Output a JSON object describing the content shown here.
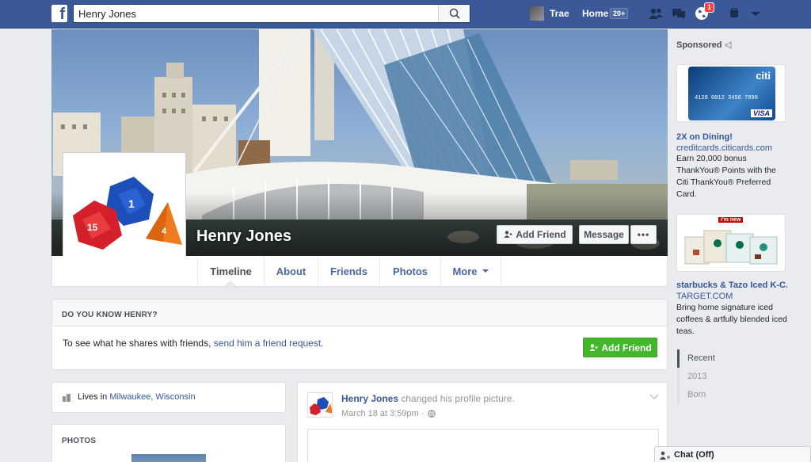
{
  "nav": {
    "search_value": "Henry Jones",
    "user_name": "Trae",
    "home_label": "Home",
    "home_count": "20+",
    "notification_count": "1"
  },
  "profile": {
    "name": "Henry Jones",
    "add_friend_label": "Add Friend",
    "message_label": "Message",
    "more_dots": "•••"
  },
  "tabs": [
    "Timeline",
    "About",
    "Friends",
    "Photos",
    "More"
  ],
  "know_card": {
    "heading": "DO YOU KNOW HENRY?",
    "text": "To see what he shares with friends, ",
    "link": "send him a friend request.",
    "button": "Add Friend"
  },
  "intro": {
    "lives_prefix": "Lives in ",
    "city": "Milwaukee, Wisconsin"
  },
  "photos_card": {
    "heading": "PHOTOS"
  },
  "post": {
    "author": "Henry Jones",
    "action": " changed his profile picture.",
    "timestamp": "March 18 at 3:59pm ·"
  },
  "sidebar": {
    "sponsored": "Sponsored",
    "ad1": {
      "title": "2X on Dining!",
      "domain": "creditcards.citicards.com",
      "text": "Earn 20,000 bonus ThankYou® Points with the Citi ThankYou® Preferred Card.",
      "card_brand": "citi",
      "card_type": "VISA",
      "card_number": "4128 0012 3456 7890"
    },
    "ad2": {
      "title": "starbucks & Tazo Iced K-C...",
      "domain": "TARGET.COM",
      "text": "Bring home signature iced coffees & artfully blended iced teas.",
      "badge": "i'm new"
    },
    "years": [
      "Recent",
      "2013",
      "Born"
    ]
  },
  "chat": {
    "label": "Chat (Off)"
  }
}
